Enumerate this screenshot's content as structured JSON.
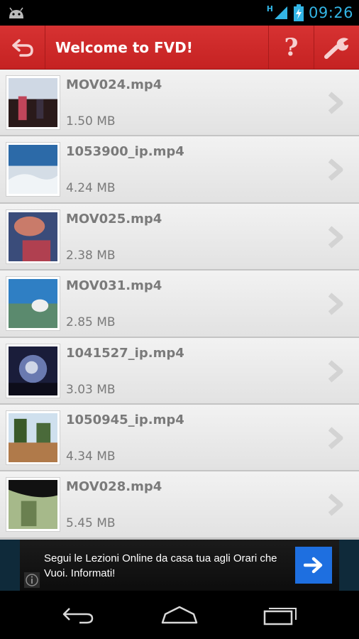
{
  "status_bar": {
    "network_type": "H",
    "time": "09:26",
    "icons": [
      "android-notification-icon",
      "signal-icon",
      "battery-charging-icon"
    ]
  },
  "action_bar": {
    "title": "Welcome to FVD!",
    "help_label": "?",
    "icons": [
      "back-icon",
      "help-icon",
      "settings-wrench-icon"
    ],
    "accent_color": "#cc2828"
  },
  "files": [
    {
      "name": "MOV024.mp4",
      "size": "1.50 MB"
    },
    {
      "name": "1053900_ip.mp4",
      "size": "4.24 MB"
    },
    {
      "name": "MOV025.mp4",
      "size": "2.38 MB"
    },
    {
      "name": "MOV031.mp4",
      "size": "2.85 MB"
    },
    {
      "name": "1041527_ip.mp4",
      "size": "3.03 MB"
    },
    {
      "name": "1050945_ip.mp4",
      "size": "4.34 MB"
    },
    {
      "name": "MOV028.mp4",
      "size": "5.45 MB"
    }
  ],
  "ad": {
    "text": "Segui le Lezioni Online da casa tua agli Orari che Vuoi. Informati!",
    "cta_icon": "arrow-right-icon",
    "info_icon": "info-icon"
  },
  "nav_bar": {
    "icons": [
      "nav-back-icon",
      "nav-home-icon",
      "nav-recents-icon"
    ]
  }
}
